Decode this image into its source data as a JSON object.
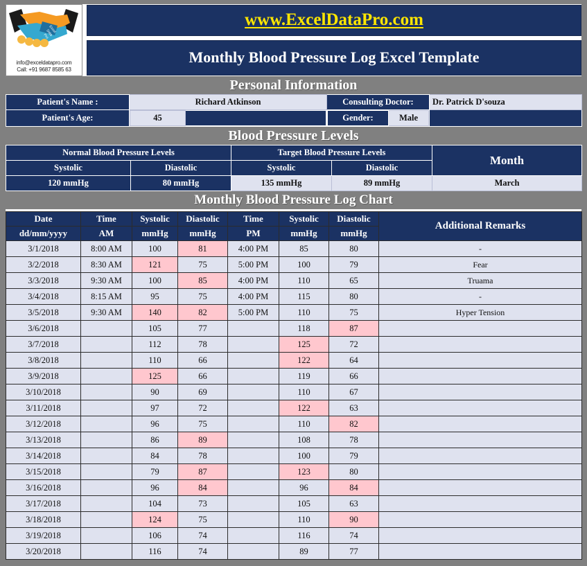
{
  "brand": {
    "logo_icon": "handshake-icon",
    "email": "info@exceldatapro.com",
    "phone": "Call: +91 9687 8585 63",
    "website": "www.ExcelDataPro.com",
    "title": "Monthly Blood Pressure Log Excel Template",
    "colors": {
      "navy": "#1b3263",
      "gray": "#808080",
      "light": "#dfe2ef",
      "yellow": "#ffe600",
      "pink": "#ffc7ce"
    }
  },
  "personal": {
    "section_title": "Personal Information",
    "name_label": "Patient's Name :",
    "name_value": "Richard Atkinson",
    "doctor_label": "Consulting Doctor:",
    "doctor_value": "Dr. Patrick D'souza",
    "age_label": "Patient's Age:",
    "age_value": "45",
    "gender_label": "Gender:",
    "gender_value": "Male"
  },
  "levels": {
    "section_title": "Blood Pressure Levels",
    "normal_group": "Normal Blood Pressure Levels",
    "target_group": "Target Blood Pressure Levels",
    "month_label": "Month",
    "normal_systolic_label": "Systolic",
    "normal_diastolic_label": "Diastolic",
    "target_systolic_label": "Systolic",
    "target_diastolic_label": "Diastolic",
    "normal_systolic_value": "120 mmHg",
    "normal_diastolic_value": "80 mmHg",
    "target_systolic_value": "135 mmHg",
    "target_diastolic_value": "89 mmHg",
    "month_value": "March"
  },
  "log": {
    "section_title": "Monthly Blood Pressure Log Chart",
    "headers_top": [
      "Date",
      "Time",
      "Systolic",
      "Diastolic",
      "Time",
      "Systolic",
      "Diastolic",
      "Additional Remarks"
    ],
    "headers_sub": [
      "dd/mm/yyyy",
      "AM",
      "mmHg",
      "mmHg",
      "PM",
      "mmHg",
      "mmHg"
    ],
    "rows": [
      {
        "date": "3/1/2018",
        "am_time": "8:00 AM",
        "am_sys": "100",
        "am_sys_hi": false,
        "am_dia": "81",
        "am_dia_hi": true,
        "pm_time": "4:00 PM",
        "pm_sys": "85",
        "pm_sys_hi": false,
        "pm_dia": "80",
        "pm_dia_hi": false,
        "remarks": "-"
      },
      {
        "date": "3/2/2018",
        "am_time": "8:30 AM",
        "am_sys": "121",
        "am_sys_hi": true,
        "am_dia": "75",
        "am_dia_hi": false,
        "pm_time": "5:00 PM",
        "pm_sys": "100",
        "pm_sys_hi": false,
        "pm_dia": "79",
        "pm_dia_hi": false,
        "remarks": "Fear"
      },
      {
        "date": "3/3/2018",
        "am_time": "9:30 AM",
        "am_sys": "100",
        "am_sys_hi": false,
        "am_dia": "85",
        "am_dia_hi": true,
        "pm_time": "4:00 PM",
        "pm_sys": "110",
        "pm_sys_hi": false,
        "pm_dia": "65",
        "pm_dia_hi": false,
        "remarks": "Truama"
      },
      {
        "date": "3/4/2018",
        "am_time": "8:15 AM",
        "am_sys": "95",
        "am_sys_hi": false,
        "am_dia": "75",
        "am_dia_hi": false,
        "pm_time": "4:00 PM",
        "pm_sys": "115",
        "pm_sys_hi": false,
        "pm_dia": "80",
        "pm_dia_hi": false,
        "remarks": "-"
      },
      {
        "date": "3/5/2018",
        "am_time": "9:30 AM",
        "am_sys": "140",
        "am_sys_hi": true,
        "am_dia": "82",
        "am_dia_hi": true,
        "pm_time": "5:00 PM",
        "pm_sys": "110",
        "pm_sys_hi": false,
        "pm_dia": "75",
        "pm_dia_hi": false,
        "remarks": "Hyper Tension"
      },
      {
        "date": "3/6/2018",
        "am_time": "",
        "am_sys": "105",
        "am_sys_hi": false,
        "am_dia": "77",
        "am_dia_hi": false,
        "pm_time": "",
        "pm_sys": "118",
        "pm_sys_hi": false,
        "pm_dia": "87",
        "pm_dia_hi": true,
        "remarks": ""
      },
      {
        "date": "3/7/2018",
        "am_time": "",
        "am_sys": "112",
        "am_sys_hi": false,
        "am_dia": "78",
        "am_dia_hi": false,
        "pm_time": "",
        "pm_sys": "125",
        "pm_sys_hi": true,
        "pm_dia": "72",
        "pm_dia_hi": false,
        "remarks": ""
      },
      {
        "date": "3/8/2018",
        "am_time": "",
        "am_sys": "110",
        "am_sys_hi": false,
        "am_dia": "66",
        "am_dia_hi": false,
        "pm_time": "",
        "pm_sys": "122",
        "pm_sys_hi": true,
        "pm_dia": "64",
        "pm_dia_hi": false,
        "remarks": ""
      },
      {
        "date": "3/9/2018",
        "am_time": "",
        "am_sys": "125",
        "am_sys_hi": true,
        "am_dia": "66",
        "am_dia_hi": false,
        "pm_time": "",
        "pm_sys": "119",
        "pm_sys_hi": false,
        "pm_dia": "66",
        "pm_dia_hi": false,
        "remarks": ""
      },
      {
        "date": "3/10/2018",
        "am_time": "",
        "am_sys": "90",
        "am_sys_hi": false,
        "am_dia": "69",
        "am_dia_hi": false,
        "pm_time": "",
        "pm_sys": "110",
        "pm_sys_hi": false,
        "pm_dia": "67",
        "pm_dia_hi": false,
        "remarks": ""
      },
      {
        "date": "3/11/2018",
        "am_time": "",
        "am_sys": "97",
        "am_sys_hi": false,
        "am_dia": "72",
        "am_dia_hi": false,
        "pm_time": "",
        "pm_sys": "122",
        "pm_sys_hi": true,
        "pm_dia": "63",
        "pm_dia_hi": false,
        "remarks": ""
      },
      {
        "date": "3/12/2018",
        "am_time": "",
        "am_sys": "96",
        "am_sys_hi": false,
        "am_dia": "75",
        "am_dia_hi": false,
        "pm_time": "",
        "pm_sys": "110",
        "pm_sys_hi": false,
        "pm_dia": "82",
        "pm_dia_hi": true,
        "remarks": ""
      },
      {
        "date": "3/13/2018",
        "am_time": "",
        "am_sys": "86",
        "am_sys_hi": false,
        "am_dia": "89",
        "am_dia_hi": true,
        "pm_time": "",
        "pm_sys": "108",
        "pm_sys_hi": false,
        "pm_dia": "78",
        "pm_dia_hi": false,
        "remarks": ""
      },
      {
        "date": "3/14/2018",
        "am_time": "",
        "am_sys": "84",
        "am_sys_hi": false,
        "am_dia": "78",
        "am_dia_hi": false,
        "pm_time": "",
        "pm_sys": "100",
        "pm_sys_hi": false,
        "pm_dia": "79",
        "pm_dia_hi": false,
        "remarks": ""
      },
      {
        "date": "3/15/2018",
        "am_time": "",
        "am_sys": "79",
        "am_sys_hi": false,
        "am_dia": "87",
        "am_dia_hi": true,
        "pm_time": "",
        "pm_sys": "123",
        "pm_sys_hi": true,
        "pm_dia": "80",
        "pm_dia_hi": false,
        "remarks": ""
      },
      {
        "date": "3/16/2018",
        "am_time": "",
        "am_sys": "96",
        "am_sys_hi": false,
        "am_dia": "84",
        "am_dia_hi": true,
        "pm_time": "",
        "pm_sys": "96",
        "pm_sys_hi": false,
        "pm_dia": "84",
        "pm_dia_hi": true,
        "remarks": ""
      },
      {
        "date": "3/17/2018",
        "am_time": "",
        "am_sys": "104",
        "am_sys_hi": false,
        "am_dia": "73",
        "am_dia_hi": false,
        "pm_time": "",
        "pm_sys": "105",
        "pm_sys_hi": false,
        "pm_dia": "63",
        "pm_dia_hi": false,
        "remarks": ""
      },
      {
        "date": "3/18/2018",
        "am_time": "",
        "am_sys": "124",
        "am_sys_hi": true,
        "am_dia": "75",
        "am_dia_hi": false,
        "pm_time": "",
        "pm_sys": "110",
        "pm_sys_hi": false,
        "pm_dia": "90",
        "pm_dia_hi": true,
        "remarks": ""
      },
      {
        "date": "3/19/2018",
        "am_time": "",
        "am_sys": "106",
        "am_sys_hi": false,
        "am_dia": "74",
        "am_dia_hi": false,
        "pm_time": "",
        "pm_sys": "116",
        "pm_sys_hi": false,
        "pm_dia": "74",
        "pm_dia_hi": false,
        "remarks": ""
      },
      {
        "date": "3/20/2018",
        "am_time": "",
        "am_sys": "116",
        "am_sys_hi": false,
        "am_dia": "74",
        "am_dia_hi": false,
        "pm_time": "",
        "pm_sys": "89",
        "pm_sys_hi": false,
        "pm_dia": "77",
        "pm_dia_hi": false,
        "remarks": ""
      }
    ]
  }
}
